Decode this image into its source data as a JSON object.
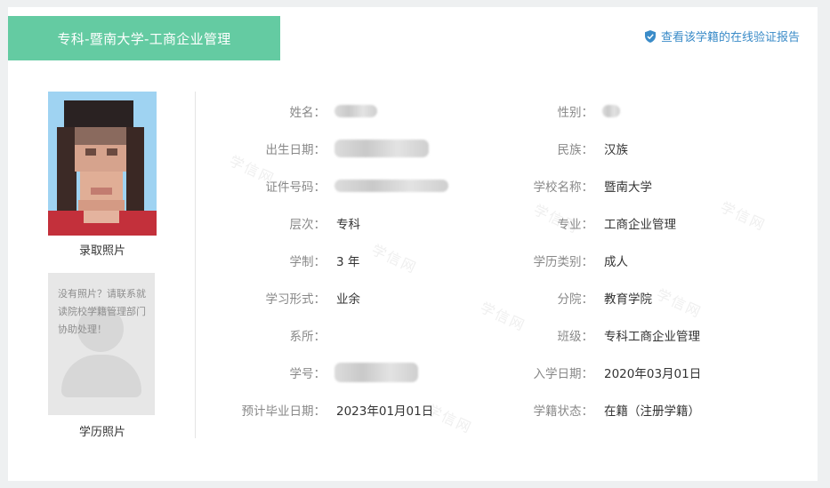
{
  "header": {
    "title": "专科-暨南大学-工商企业管理",
    "verify_link": "查看该学籍的在线验证报告"
  },
  "photos": {
    "admission_caption": "录取照片",
    "education_caption": "学历照片",
    "no_photo_message": "没有照片？请联系就读院校学籍管理部门协助处理！"
  },
  "watermark_text": "学信网",
  "fields": {
    "name": {
      "label": "姓名：",
      "value": ""
    },
    "gender": {
      "label": "性别：",
      "value": ""
    },
    "birth_date": {
      "label": "出生日期：",
      "value": ""
    },
    "ethnicity": {
      "label": "民族：",
      "value": "汉族"
    },
    "id_number": {
      "label": "证件号码：",
      "value": ""
    },
    "school": {
      "label": "学校名称：",
      "value": "暨南大学"
    },
    "level": {
      "label": "层次：",
      "value": "专科"
    },
    "major": {
      "label": "专业：",
      "value": "工商企业管理"
    },
    "duration": {
      "label": "学制：",
      "value": "3 年"
    },
    "education_type": {
      "label": "学历类别：",
      "value": "成人"
    },
    "study_form": {
      "label": "学习形式：",
      "value": "业余"
    },
    "branch": {
      "label": "分院：",
      "value": "教育学院"
    },
    "department": {
      "label": "系所：",
      "value": ""
    },
    "class": {
      "label": "班级：",
      "value": "专科工商企业管理"
    },
    "student_id": {
      "label": "学号：",
      "value": ""
    },
    "enroll_date": {
      "label": "入学日期：",
      "value": "2020年03月01日"
    },
    "expected_grad": {
      "label": "预计毕业日期：",
      "value": "2023年01月01日"
    },
    "status": {
      "label": "学籍状态：",
      "value": "在籍（注册学籍）"
    }
  },
  "colors": {
    "header_bg": "#64cba2",
    "link": "#3a8bc8",
    "label": "#888888",
    "value": "#333333"
  },
  "icons": {
    "verify": "shield-check-icon",
    "placeholder": "user-silhouette-icon"
  }
}
